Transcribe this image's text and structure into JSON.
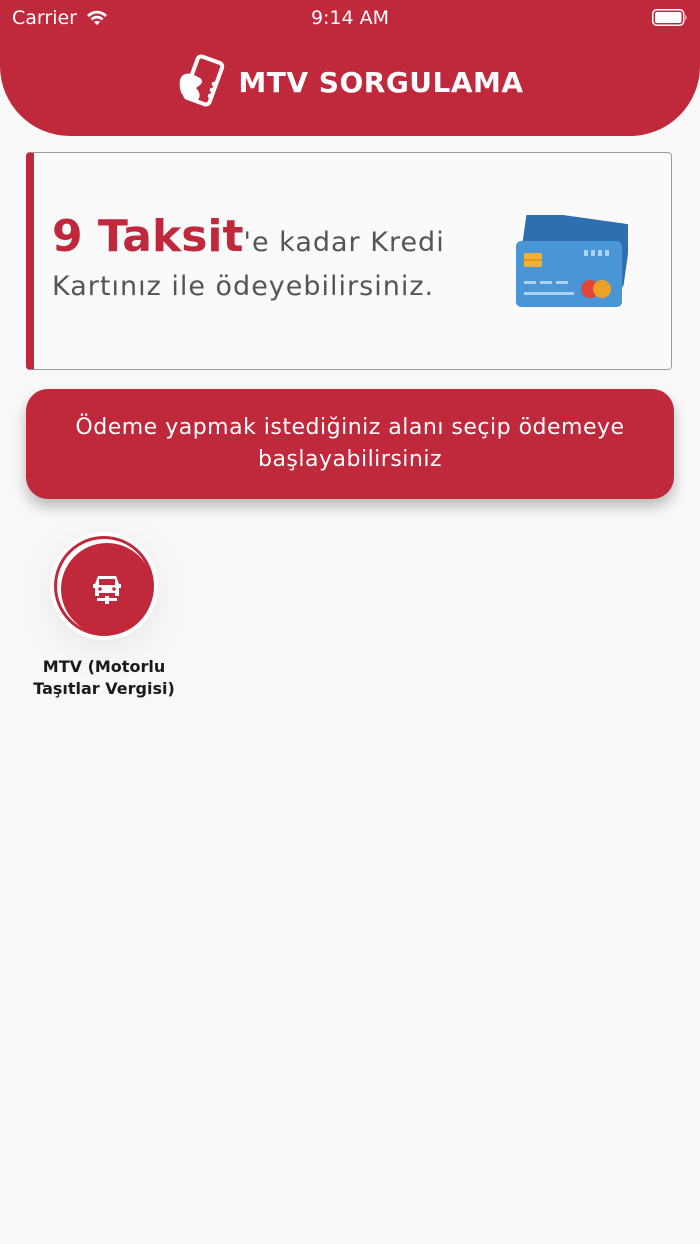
{
  "status_bar": {
    "carrier": "Carrier",
    "time": "9:14 AM"
  },
  "header": {
    "title": "MTV SORGULAMA",
    "icon": "phone-hand-icon",
    "color": "#c0293b"
  },
  "promo": {
    "highlight": "9 Taksit",
    "text": "'e kadar Kredi Kartınız ile ödeyebilirsiniz.",
    "icon": "credit-card-icon"
  },
  "banner": {
    "text": "Ödeme yapmak istediğiniz alanı seçip ödemeye başlayabilirsiniz"
  },
  "services": [
    {
      "label": "MTV (Motorlu Taşıtlar Vergisi)",
      "icon": "car-icon"
    }
  ]
}
